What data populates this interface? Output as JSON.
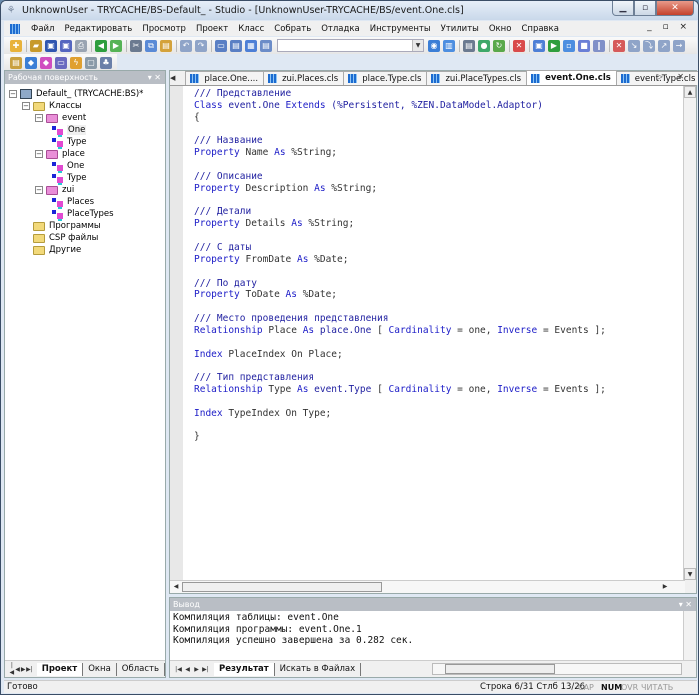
{
  "window": {
    "title": "UnknownUser - TRYCACHE/BS-Default_ - Studio - [UnknownUser-TRYCACHE/BS/event.One.cls]",
    "controls": [
      "minimize",
      "maximize",
      "close"
    ]
  },
  "menubar": {
    "items": [
      "Файл",
      "Редактировать",
      "Просмотр",
      "Проект",
      "Класс",
      "Собрать",
      "Отладка",
      "Инструменты",
      "Утилиты",
      "Окно",
      "Справка"
    ],
    "mdi_controls": "_ ▫ ×"
  },
  "toolbar": {
    "main_icons": [
      "new-icon",
      "open-icon",
      "save-icon",
      "save-all-icon",
      "print-icon",
      "back-icon",
      "forward-icon",
      "cut-icon",
      "copy-icon",
      "paste-icon",
      "undo-icon",
      "redo-icon",
      "view-class-icon",
      "view-doc-icon",
      "inspector-icon",
      "wizard-icon"
    ],
    "combo_value": "",
    "right_icons": [
      "compile-icon",
      "build-icon",
      "view-other-icon",
      "web-icon",
      "refresh-icon",
      "stop-icon",
      "debug-target-icon",
      "run-icon",
      "step-icon",
      "stop-debug-icon",
      "pause-icon",
      "remove-breakpoint-icon",
      "step-in-icon",
      "step-over-icon",
      "step-out-icon",
      "run-to-cursor-icon"
    ],
    "secondary_icons": [
      "add-property-icon",
      "add-method-icon",
      "add-index-icon",
      "add-query-icon",
      "add-trigger-icon",
      "add-parameter-icon",
      "add-relationship-icon"
    ]
  },
  "workspace": {
    "header": "Рабочая поверхность",
    "tree": [
      {
        "label": "Default_ (TRYCACHE:BS)*",
        "level": 0,
        "type": "project",
        "expanded": true
      },
      {
        "label": "Классы",
        "level": 1,
        "type": "folder",
        "expanded": true
      },
      {
        "label": "event",
        "level": 2,
        "type": "package",
        "expanded": true
      },
      {
        "label": "One",
        "level": 3,
        "type": "class",
        "selected": true
      },
      {
        "label": "Type",
        "level": 3,
        "type": "class"
      },
      {
        "label": "place",
        "level": 2,
        "type": "package",
        "expanded": true
      },
      {
        "label": "One",
        "level": 3,
        "type": "class"
      },
      {
        "label": "Type",
        "level": 3,
        "type": "class"
      },
      {
        "label": "zui",
        "level": 2,
        "type": "package",
        "expanded": true
      },
      {
        "label": "Places",
        "level": 3,
        "type": "class"
      },
      {
        "label": "PlaceTypes",
        "level": 3,
        "type": "class"
      },
      {
        "label": "Программы",
        "level": 1,
        "type": "folder"
      },
      {
        "label": "CSP файлы",
        "level": 1,
        "type": "folder"
      },
      {
        "label": "Другие",
        "level": 1,
        "type": "folder"
      }
    ],
    "bottom_tabs": [
      "Проект",
      "Окна",
      "Область"
    ],
    "active_bottom_tab": "Проект"
  },
  "editor": {
    "tabs": [
      "place.One....",
      "zui.Places.cls",
      "place.Type.cls",
      "zui.PlaceTypes.cls",
      "event.One.cls",
      "event.Type.cls"
    ],
    "active_tab": "event.One.cls",
    "code_lines": [
      [
        {
          "t": "/// Представление",
          "c": "cm"
        }
      ],
      [
        {
          "t": "Class ",
          "c": "kw"
        },
        {
          "t": "event.One ",
          "c": "cm"
        },
        {
          "t": "Extends ",
          "c": "kw"
        },
        {
          "t": "(%Persistent, %ZEN.DataModel.Adaptor)",
          "c": "cm"
        }
      ],
      [
        {
          "t": "{",
          "c": "tx"
        }
      ],
      [
        {
          "t": "",
          "c": "tx"
        }
      ],
      [
        {
          "t": "/// Название",
          "c": "cm"
        }
      ],
      [
        {
          "t": "Property ",
          "c": "kw"
        },
        {
          "t": "Name ",
          "c": "tx"
        },
        {
          "t": "As ",
          "c": "kw"
        },
        {
          "t": "%String;",
          "c": "tx"
        }
      ],
      [
        {
          "t": "",
          "c": "tx"
        }
      ],
      [
        {
          "t": "/// Описание",
          "c": "cm"
        }
      ],
      [
        {
          "t": "Property ",
          "c": "kw"
        },
        {
          "t": "Description ",
          "c": "tx"
        },
        {
          "t": "As ",
          "c": "kw"
        },
        {
          "t": "%String;",
          "c": "tx"
        }
      ],
      [
        {
          "t": "",
          "c": "tx"
        }
      ],
      [
        {
          "t": "/// Детали",
          "c": "cm"
        }
      ],
      [
        {
          "t": "Property ",
          "c": "kw"
        },
        {
          "t": "Details ",
          "c": "tx"
        },
        {
          "t": "As ",
          "c": "kw"
        },
        {
          "t": "%String;",
          "c": "tx"
        }
      ],
      [
        {
          "t": "",
          "c": "tx"
        }
      ],
      [
        {
          "t": "/// С даты",
          "c": "cm"
        }
      ],
      [
        {
          "t": "Property ",
          "c": "kw"
        },
        {
          "t": "FromDate ",
          "c": "tx"
        },
        {
          "t": "As ",
          "c": "kw"
        },
        {
          "t": "%Date;",
          "c": "tx"
        }
      ],
      [
        {
          "t": "",
          "c": "tx"
        }
      ],
      [
        {
          "t": "/// По дату",
          "c": "cm"
        }
      ],
      [
        {
          "t": "Property ",
          "c": "kw"
        },
        {
          "t": "ToDate ",
          "c": "tx"
        },
        {
          "t": "As ",
          "c": "kw"
        },
        {
          "t": "%Date;",
          "c": "tx"
        }
      ],
      [
        {
          "t": "",
          "c": "tx"
        }
      ],
      [
        {
          "t": "/// Место проведения представления",
          "c": "cm"
        }
      ],
      [
        {
          "t": "Relationship ",
          "c": "kw"
        },
        {
          "t": "Place ",
          "c": "tx"
        },
        {
          "t": "As ",
          "c": "kw"
        },
        {
          "t": "place.One ",
          "c": "cm"
        },
        {
          "t": "[ ",
          "c": "tx"
        },
        {
          "t": "Cardinality ",
          "c": "kw"
        },
        {
          "t": "= one, ",
          "c": "tx"
        },
        {
          "t": "Inverse ",
          "c": "kw"
        },
        {
          "t": "= Events ];",
          "c": "tx"
        }
      ],
      [
        {
          "t": "",
          "c": "tx"
        }
      ],
      [
        {
          "t": "Index ",
          "c": "kw"
        },
        {
          "t": "PlaceIndex On Place;",
          "c": "tx"
        }
      ],
      [
        {
          "t": "",
          "c": "tx"
        }
      ],
      [
        {
          "t": "/// Тип представления",
          "c": "cm"
        }
      ],
      [
        {
          "t": "Relationship ",
          "c": "kw"
        },
        {
          "t": "Type ",
          "c": "tx"
        },
        {
          "t": "As ",
          "c": "kw"
        },
        {
          "t": "event.Type ",
          "c": "cm"
        },
        {
          "t": "[ ",
          "c": "tx"
        },
        {
          "t": "Cardinality ",
          "c": "kw"
        },
        {
          "t": "= one, ",
          "c": "tx"
        },
        {
          "t": "Inverse ",
          "c": "kw"
        },
        {
          "t": "= Events ];",
          "c": "tx"
        }
      ],
      [
        {
          "t": "",
          "c": "tx"
        }
      ],
      [
        {
          "t": "Index ",
          "c": "kw"
        },
        {
          "t": "TypeIndex On Type;",
          "c": "tx"
        }
      ],
      [
        {
          "t": "",
          "c": "tx"
        }
      ],
      [
        {
          "t": "}",
          "c": "tx"
        }
      ]
    ]
  },
  "output": {
    "header": "Вывод",
    "lines": [
      "Компиляция таблицы: event.One",
      "Компиляция программы: event.One.1",
      "Компиляция успешно завершена за 0.282 сек."
    ],
    "tabs": [
      "Результат",
      "Искать в Файлах"
    ],
    "active_tab": "Результат"
  },
  "statusbar": {
    "status": "Готово",
    "position": "Строка 6/31 Стлб 13/26",
    "indicators": [
      {
        "label": "CAP",
        "on": false
      },
      {
        "label": "NUM",
        "on": true
      },
      {
        "label": "OVR",
        "on": false
      },
      {
        "label": "ЧИТАТЬ",
        "on": false
      }
    ]
  },
  "colors": {
    "comment": "#1f1fa0",
    "keyword": "#2020c8",
    "text": "#333333",
    "panel_header": "#b9bec5"
  }
}
